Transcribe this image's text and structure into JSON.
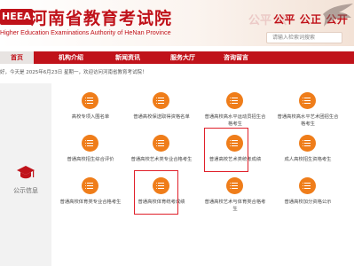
{
  "header": {
    "logo_badge": "HEEA",
    "title": "河南省教育考试院",
    "subtitle": "Higher Education Examinations Authority of HeNan Province",
    "motto_ghost": "公平 公",
    "motto": "公平 公正 公开",
    "search_placeholder": "请输入检索词搜索"
  },
  "nav": {
    "items": [
      {
        "label": "首页",
        "active": true
      },
      {
        "label": "机构介绍",
        "active": false
      },
      {
        "label": "新闻资讯",
        "active": false
      },
      {
        "label": "服务大厅",
        "active": false
      },
      {
        "label": "咨询留言",
        "active": false
      }
    ]
  },
  "notice": {
    "text": "好，今天是 2025年6月23日 星期一，欢迎访问河南省教育考试院！"
  },
  "left": {
    "label": "公示信息"
  },
  "cards": [
    {
      "label": "高校专项入围名单"
    },
    {
      "label": "普通高校保送取得资格名单"
    },
    {
      "label": "普通高校高水平运动员招生合格考生"
    },
    {
      "label": "普通高校高水平艺术团招生合格考生"
    },
    {
      "label": "普通高校招生综合评价"
    },
    {
      "label": "普通高校艺术类专业合格考生"
    },
    {
      "label": "普通高校艺术类统考成绩"
    },
    {
      "label": "成人高校招生资格考生"
    },
    {
      "label": "普通高校体育类专业合格考生"
    },
    {
      "label": "普通高校体育统考成绩"
    },
    {
      "label": "普通高校艺术与体育类合格考生"
    },
    {
      "label": "普通高校加分资格公示"
    }
  ],
  "colors": {
    "brand_red": "#c0121a",
    "icon_orange": "#ef7d1a",
    "highlight": "#e0202a"
  }
}
